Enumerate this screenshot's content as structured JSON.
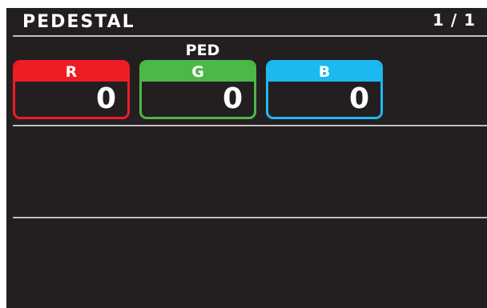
{
  "header": {
    "title": "PEDESTAL",
    "page": "1 / 1"
  },
  "group": {
    "label": "PED"
  },
  "params": [
    {
      "label": "R",
      "value": "0",
      "color": "#ee1c25"
    },
    {
      "label": "G",
      "value": "0",
      "color": "#4cb848"
    },
    {
      "label": "B",
      "value": "0",
      "color": "#1cb9f0"
    }
  ]
}
